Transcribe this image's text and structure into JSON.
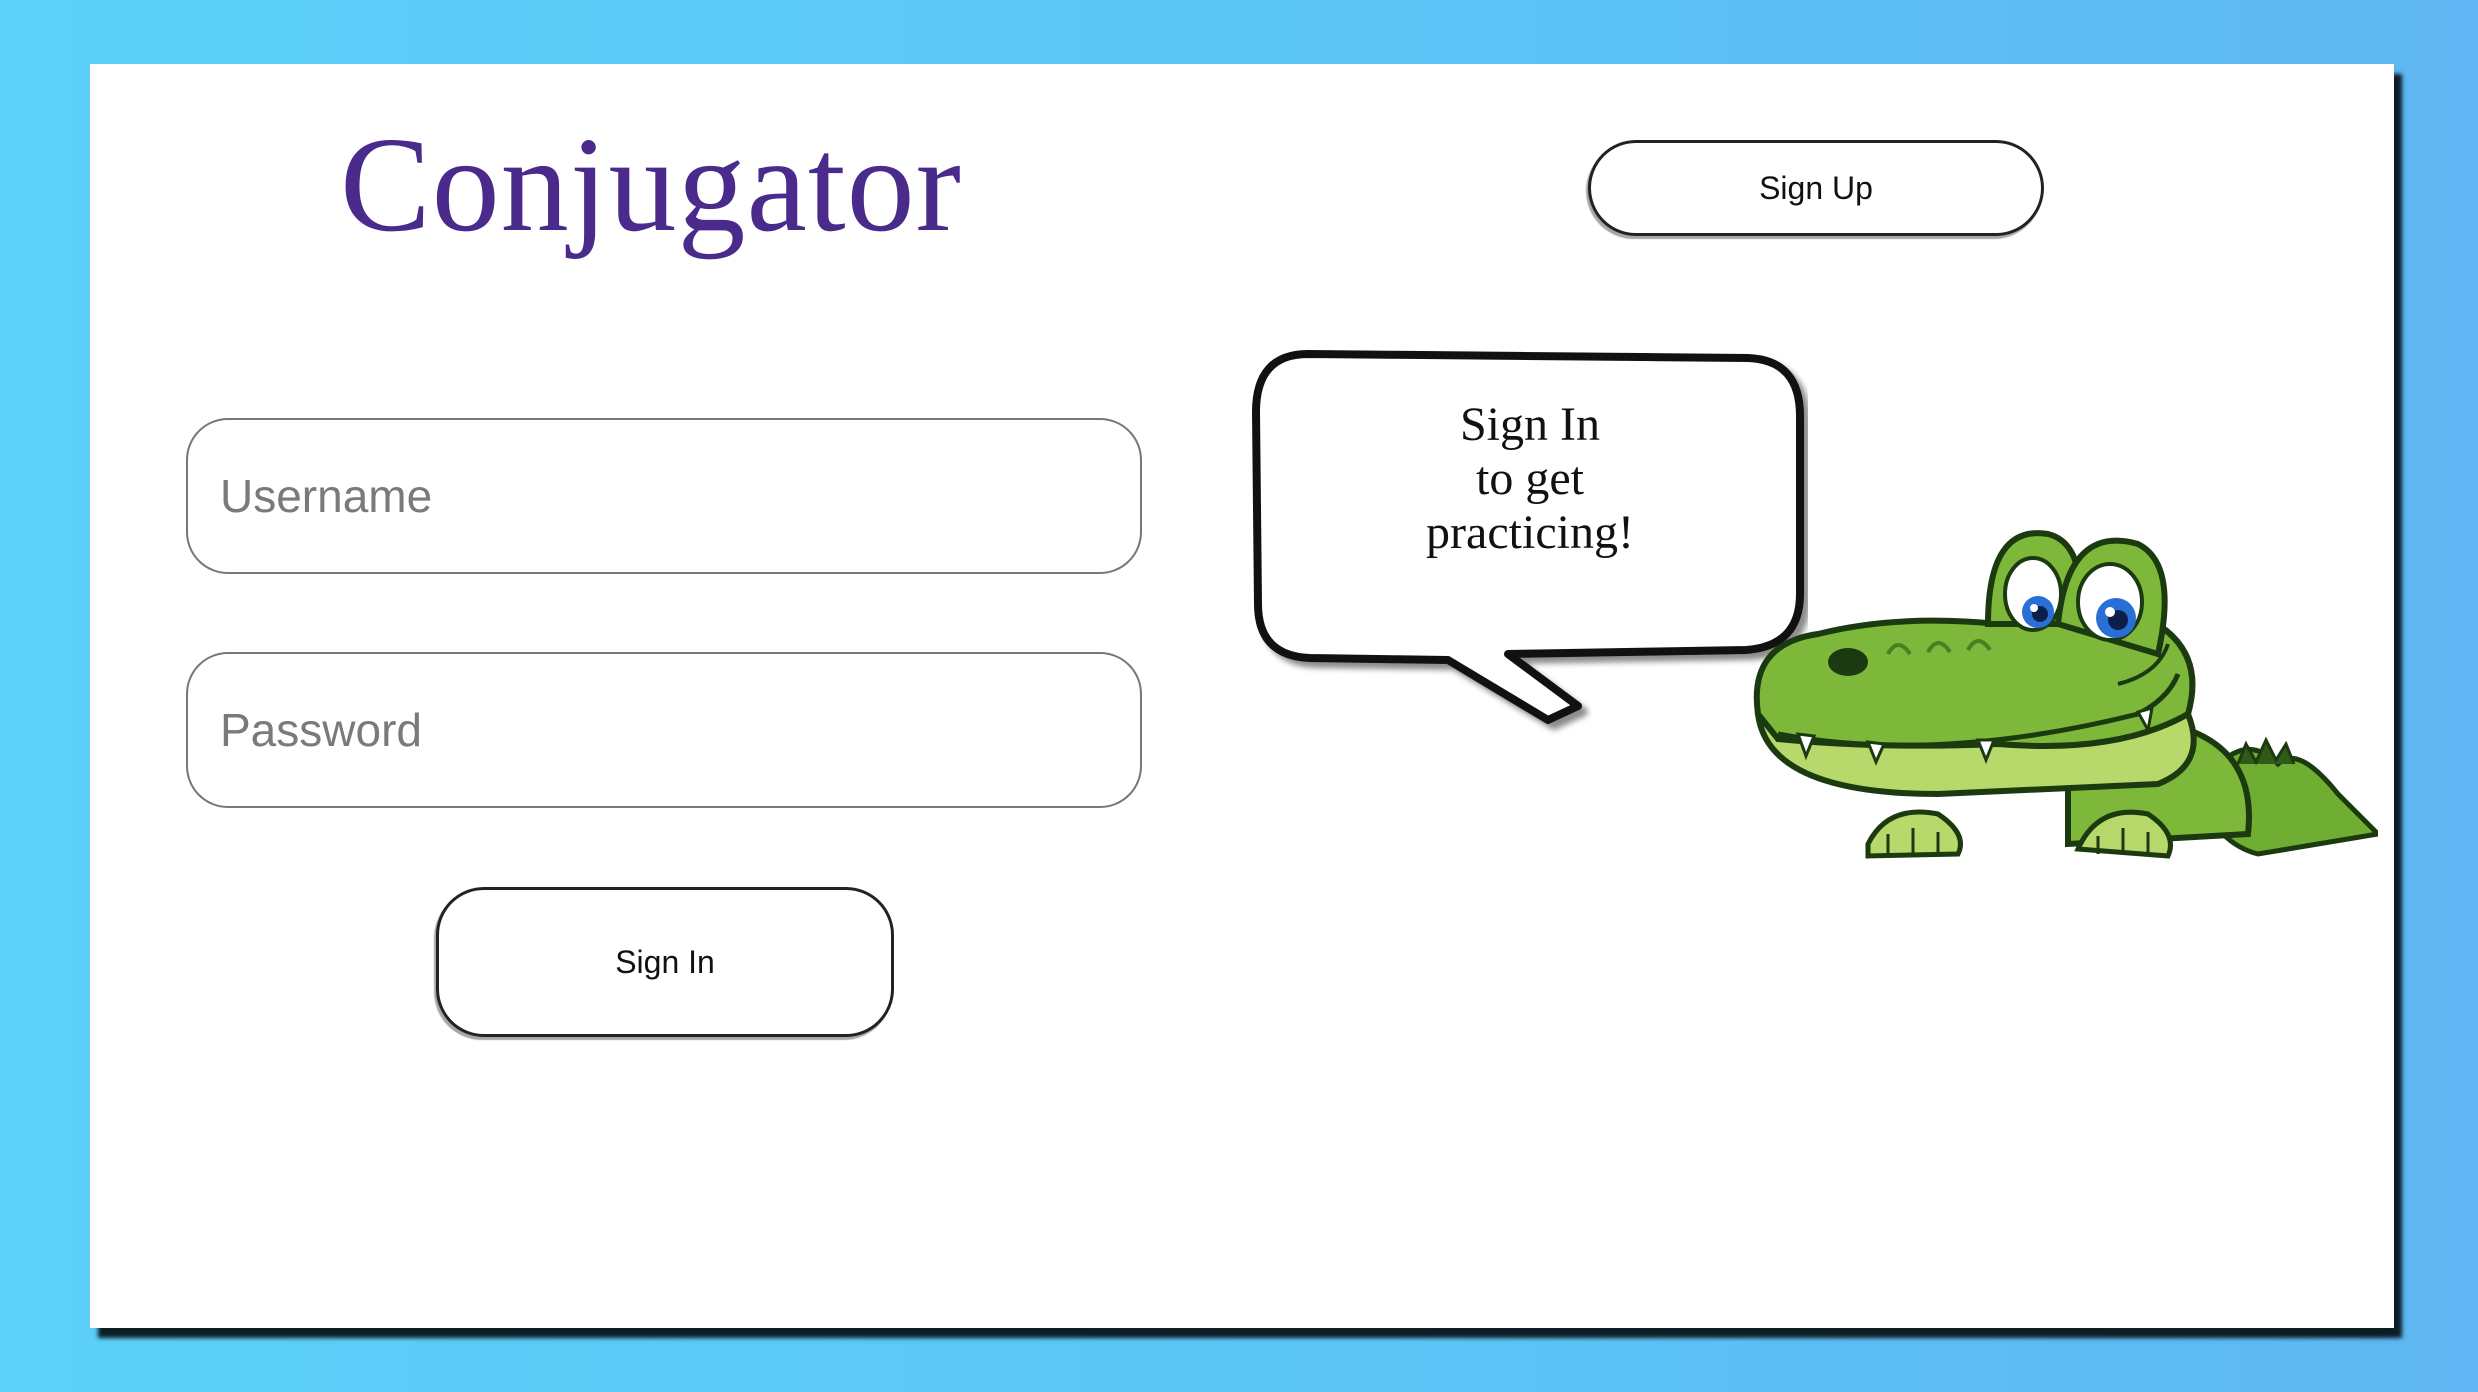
{
  "app": {
    "title": "Conjugator"
  },
  "header": {
    "signup_label": "Sign Up"
  },
  "form": {
    "username_placeholder": "Username",
    "password_placeholder": "Password",
    "signin_label": "Sign In"
  },
  "bubble": {
    "lines": [
      "Sign In",
      "to get",
      "practicing!"
    ]
  },
  "mascot": {
    "icon": "alligator-mascot-icon"
  },
  "colors": {
    "background_top": "#5bd0f8",
    "background_right": "#5fb6f2",
    "title": "#4a2a8a",
    "mascot_green": "#7db83a",
    "mascot_eye": "#2a6fd6"
  }
}
